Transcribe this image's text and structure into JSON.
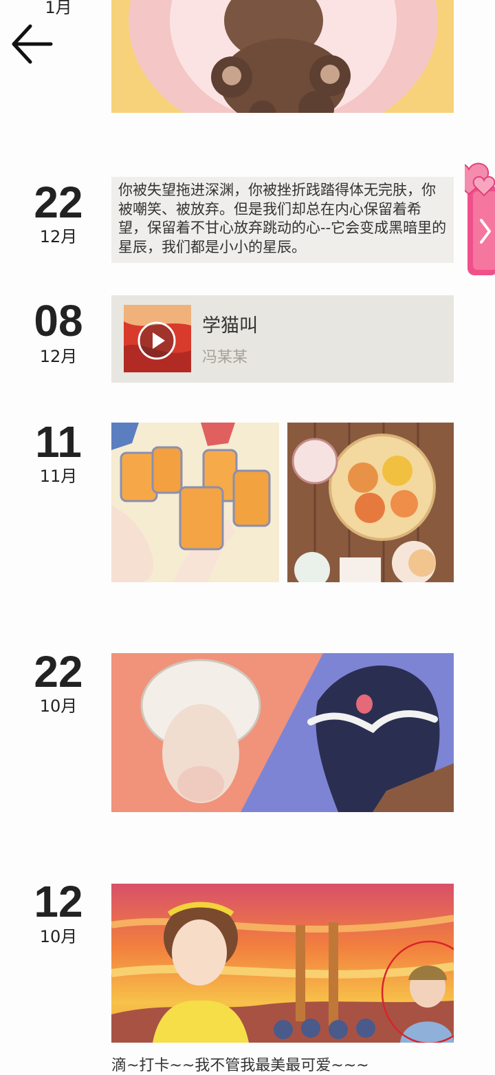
{
  "header": {
    "top_month": "1月",
    "back_icon": "arrow-left-icon"
  },
  "entries": [
    {
      "day": "22",
      "month": "12月",
      "type": "text",
      "text": "你被失望拖进深渊，你被挫折践踏得体无完肤，你被嘲笑、被放弃。但是我们却总在内心保留着希望，保留着不甘心放弃跳动的心--它会变成黑暗里的星辰，我们都是小小的星辰。"
    },
    {
      "day": "08",
      "month": "12月",
      "type": "music",
      "title": "学猫叫",
      "artist": "冯某某",
      "play_icon": "play-icon"
    },
    {
      "day": "11",
      "month": "11月",
      "type": "images"
    },
    {
      "day": "22",
      "month": "10月",
      "type": "image"
    },
    {
      "day": "12",
      "month": "10月",
      "type": "image",
      "caption": "滴~打卡~~我不管我最美最可爱~~~"
    }
  ],
  "side_tab": {
    "icon": "chevron-right-icon",
    "decoration": "hearts-icon",
    "color": "#f0508a"
  },
  "colors": {
    "accent_pink": "#f0508a",
    "music_card_bg": "#e8e6e0",
    "text_card_bg": "#efeeeb"
  }
}
